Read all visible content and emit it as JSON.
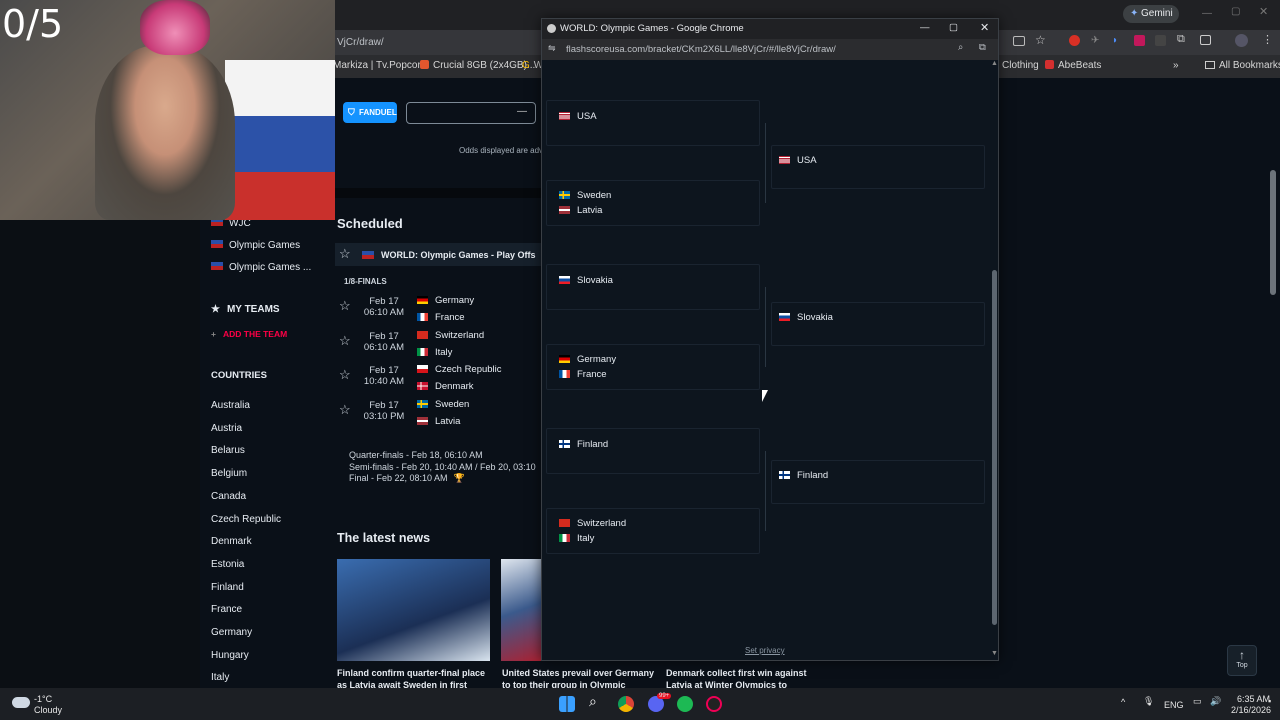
{
  "webcam": {
    "counter": "0/5"
  },
  "bg_browser": {
    "address_fragment": "VjCr/draw/",
    "gemini_label": "Gemini",
    "bookmarks": [
      "Markiza | Tv.Popcor...",
      "Crucial 8GB (2x4GB)...",
      "W",
      "Clothing",
      "AbeBeats",
      "All Bookmarks"
    ]
  },
  "odds": {
    "brand": "FANDUEL",
    "note": "Odds displayed are adv"
  },
  "sidebar": {
    "top_items": [
      "WJC",
      "Olympic Games",
      "Olympic Games ..."
    ],
    "my_teams": "MY TEAMS",
    "add_team": "ADD THE TEAM",
    "countries_header": "COUNTRIES",
    "countries": [
      "Australia",
      "Austria",
      "Belarus",
      "Belgium",
      "Canada",
      "Czech Republic",
      "Denmark",
      "Estonia",
      "Finland",
      "France",
      "Germany",
      "Hungary",
      "Italy"
    ]
  },
  "scheduled": {
    "title": "Scheduled",
    "competition": "WORLD: Olympic Games - Play Offs",
    "round": "1/8-FINALS",
    "matches": [
      {
        "date": "Feb 17",
        "time": "06:10 AM",
        "home": "Germany",
        "away": "France"
      },
      {
        "date": "Feb 17",
        "time": "06:10 AM",
        "home": "Switzerland",
        "away": "Italy"
      },
      {
        "date": "Feb 17",
        "time": "10:40 AM",
        "home": "Czech Republic",
        "away": "Denmark"
      },
      {
        "date": "Feb 17",
        "time": "03:10 PM",
        "home": "Sweden",
        "away": "Latvia"
      }
    ],
    "upcoming": [
      "Quarter-finals - Feb 18, 06:10 AM",
      "Semi-finals - Feb 20, 10:40 AM / Feb 20, 03:10",
      "Final - Feb 22, 08:10 AM"
    ]
  },
  "news": {
    "title": "The latest news",
    "items": [
      "Finland confirm quarter-final place as Latvia await Sweden in first",
      "United States prevail over Germany to top their group in Olympic",
      "Denmark collect first win against Latvia at Winter Olympics to"
    ]
  },
  "popup": {
    "title": "WORLD: Olympic Games - Google Chrome",
    "url": "flashscoreusa.com/bracket/CKm2X6LL/lle8VjCr/#/lle8VjCr/draw/",
    "left_boxes": [
      {
        "teams": [
          "USA"
        ]
      },
      {
        "teams": [
          "Sweden",
          "Latvia"
        ]
      },
      {
        "teams": [
          "Slovakia"
        ]
      },
      {
        "teams": [
          "Germany",
          "France"
        ]
      },
      {
        "teams": [
          "Finland"
        ]
      },
      {
        "teams": [
          "Switzerland",
          "Italy"
        ]
      }
    ],
    "right_boxes": [
      {
        "teams": [
          "USA"
        ]
      },
      {
        "teams": [
          "Slovakia"
        ]
      },
      {
        "teams": [
          "Finland"
        ]
      }
    ],
    "footer": "Set privacy"
  },
  "top_button": "Top",
  "taskbar": {
    "weather_temp": "-1°C",
    "weather_desc": "Cloudy",
    "lang": "ENG",
    "time": "6:35 AM",
    "date": "2/16/2026",
    "discord_badge": "99+"
  },
  "colors": {
    "accent_red": "#ff0046",
    "fanduel_blue": "#1493ff",
    "page_bg": "#0a1018"
  }
}
